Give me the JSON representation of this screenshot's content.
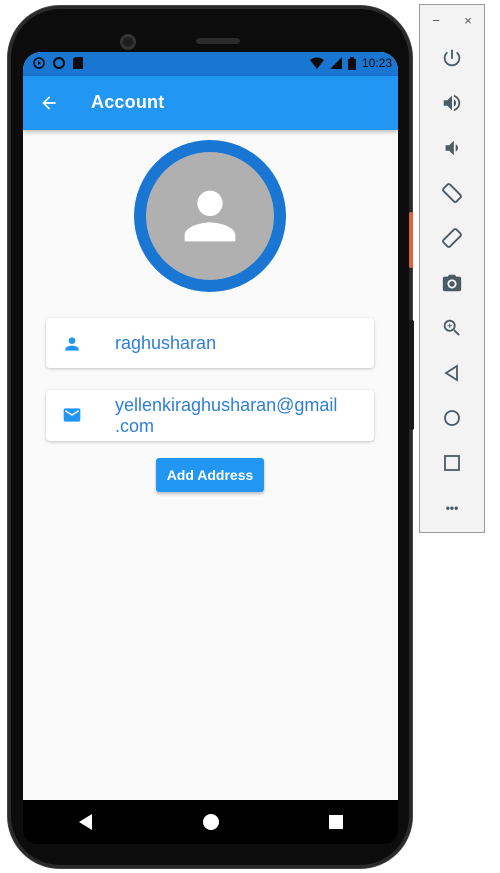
{
  "status_bar": {
    "time": "10:23"
  },
  "app_bar": {
    "title": "Account"
  },
  "profile": {
    "username": "raghusharan",
    "email_line1": "yellenkiraghusharan@gmail",
    "email_line2": ".com"
  },
  "actions": {
    "add_address_label": "Add Address"
  },
  "toolbar": {
    "minimize_label": "−",
    "close_label": "×",
    "more_label": "•••"
  },
  "colors": {
    "primary": "#2196f3",
    "primary_dark": "#1976d2",
    "avatar_bg": "#b0b0b0",
    "link_text": "#2f7fd6"
  }
}
